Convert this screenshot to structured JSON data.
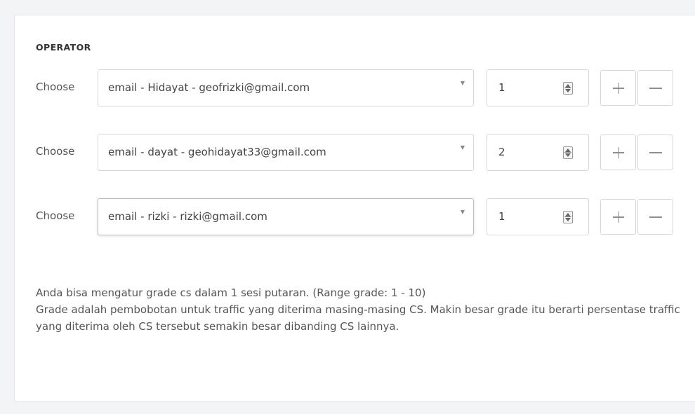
{
  "section_title": "OPERATOR",
  "rows": [
    {
      "label": "Choose",
      "selected": "email - Hidayat - geofrizki@gmail.com",
      "grade": "1"
    },
    {
      "label": "Choose",
      "selected": "email - dayat - geohidayat33@gmail.com",
      "grade": "2"
    },
    {
      "label": "Choose",
      "selected": "email - rizki - rizki@gmail.com",
      "grade": "1"
    }
  ],
  "icons": {
    "caret": "caret-down-icon",
    "spinner": "spinner-icon",
    "add": "plus-icon",
    "remove": "minus-icon"
  },
  "help": {
    "line1": "Anda bisa mengatur grade cs dalam 1 sesi putaran. (Range grade: 1 - 10)",
    "line2": "Grade adalah pembobotan untuk traffic yang diterima masing-masing CS. Makin besar grade itu berarti persentase traffic yang diterima oleh CS tersebut semakin besar dibanding CS lainnya."
  }
}
